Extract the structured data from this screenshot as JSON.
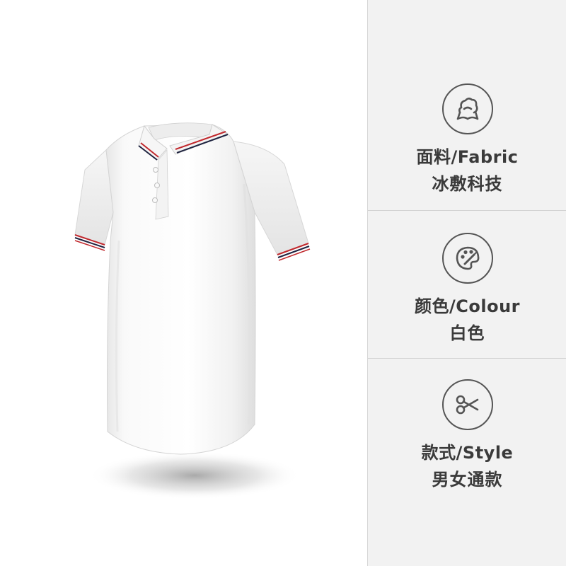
{
  "specs": [
    {
      "title": "面料/Fabric",
      "value": "冰敷科技",
      "icon": "fabric-cloud-icon"
    },
    {
      "title": "颜色/Colour",
      "value": "白色",
      "icon": "palette-icon"
    },
    {
      "title": "款式/Style",
      "value": "男女通款",
      "icon": "scissors-icon"
    }
  ],
  "colors": {
    "panel_bg": "#f2f2f2",
    "text": "#3a3a3a",
    "icon": "#555555",
    "shirt": "#ffffff",
    "trim_red": "#c0282d",
    "trim_navy": "#1f2440"
  },
  "product": {
    "image_name": "white-polo-shirt",
    "icon": "polo-shirt-image"
  }
}
